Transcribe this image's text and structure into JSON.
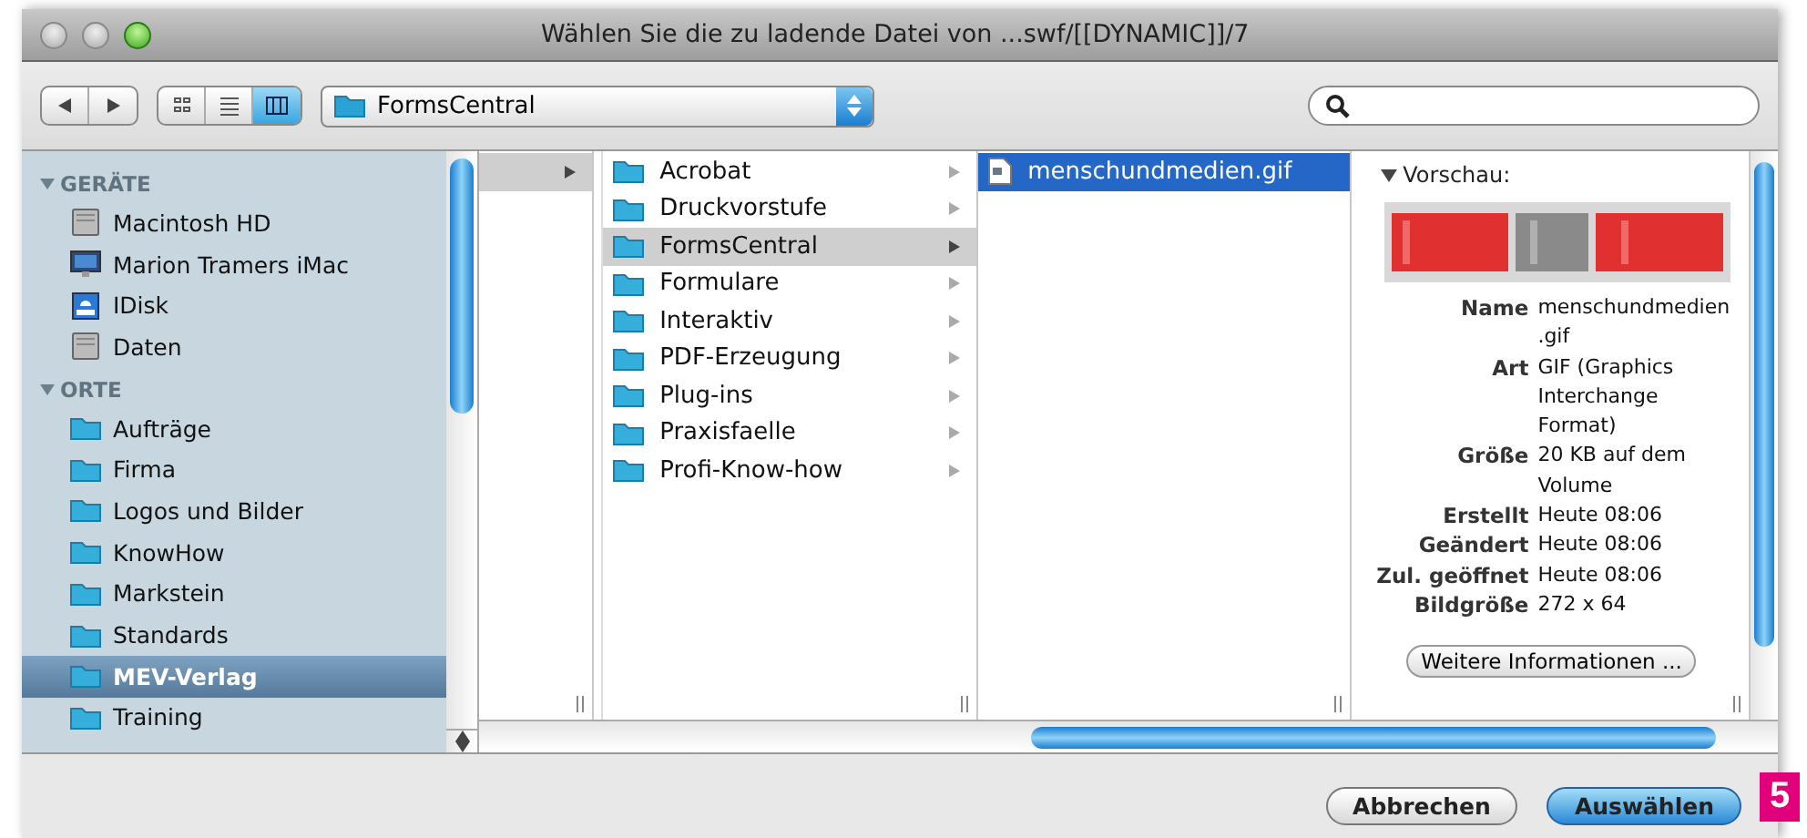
{
  "window": {
    "title": "Wählen Sie die zu ladende Datei von ...swf/[[DYNAMIC]]/7"
  },
  "toolbar": {
    "view_modes": [
      {
        "kind": "icons",
        "selected": false
      },
      {
        "kind": "list",
        "selected": false
      },
      {
        "kind": "columns",
        "selected": true
      }
    ],
    "location": "FormsCentral"
  },
  "sidebar": {
    "sections": [
      {
        "title": "GERÄTE",
        "expanded": true,
        "items": [
          {
            "label": "Macintosh HD",
            "kind": "disk",
            "selected": false
          },
          {
            "label": "Marion Tramers iMac",
            "kind": "computer",
            "selected": false
          },
          {
            "label": "IDisk",
            "kind": "idisk",
            "selected": false
          },
          {
            "label": "Daten",
            "kind": "disk",
            "selected": false
          }
        ]
      },
      {
        "title": "ORTE",
        "expanded": true,
        "items": [
          {
            "label": "Aufträge",
            "kind": "folder",
            "selected": false
          },
          {
            "label": "Firma",
            "kind": "folder",
            "selected": false
          },
          {
            "label": "Logos und Bilder",
            "kind": "folder",
            "selected": false
          },
          {
            "label": "KnowHow",
            "kind": "folder",
            "selected": false
          },
          {
            "label": "Markstein",
            "kind": "folder",
            "selected": false
          },
          {
            "label": "Standards",
            "kind": "folder",
            "selected": false
          },
          {
            "label": "MEV-Verlag",
            "kind": "folder",
            "selected": true
          },
          {
            "label": "Training",
            "kind": "folder",
            "selected": false
          }
        ]
      }
    ]
  },
  "columns": [
    {
      "active": false,
      "items": [
        {
          "kind": "blank",
          "selected": true,
          "has_children": true
        }
      ]
    },
    {
      "active": false,
      "items": [
        {
          "label": "Acrobat",
          "kind": "folder",
          "selected": false,
          "has_children": true
        },
        {
          "label": "Druckvorstufe",
          "kind": "folder",
          "selected": false,
          "has_children": true
        },
        {
          "label": "FormsCentral",
          "kind": "folder",
          "selected": true,
          "has_children": true
        },
        {
          "label": "Formulare",
          "kind": "folder",
          "selected": false,
          "has_children": true
        },
        {
          "label": "Interaktiv",
          "kind": "folder",
          "selected": false,
          "has_children": true
        },
        {
          "label": "PDF-Erzeugung",
          "kind": "folder",
          "selected": false,
          "has_children": true
        },
        {
          "label": "Plug-ins",
          "kind": "folder",
          "selected": false,
          "has_children": true
        },
        {
          "label": "Praxisfaelle",
          "kind": "folder",
          "selected": false,
          "has_children": true
        },
        {
          "label": "Profi-Know-how",
          "kind": "folder",
          "selected": false,
          "has_children": true
        }
      ]
    },
    {
      "active": true,
      "items": [
        {
          "label": "menschundmedien.gif",
          "kind": "file",
          "selected": true,
          "has_children": false
        }
      ]
    }
  ],
  "preview": {
    "title": "Vorschau:",
    "expanded": true,
    "fields": [
      {
        "label": "Name",
        "lines": [
          "menschundmedien",
          ".gif"
        ]
      },
      {
        "label": "Art",
        "lines": [
          "GIF (Graphics",
          "Interchange",
          "Format)"
        ]
      },
      {
        "label": "Größe",
        "lines": [
          "20 KB auf dem",
          "Volume"
        ]
      },
      {
        "label": "Erstellt",
        "lines": [
          "Heute 08:06"
        ]
      },
      {
        "label": "Geändert",
        "lines": [
          "Heute 08:06"
        ]
      },
      {
        "label": "Zul. geöffnet",
        "lines": [
          "Heute 08:06"
        ]
      },
      {
        "label": "Bildgröße",
        "lines": [
          "272 x 64"
        ]
      }
    ],
    "more_button": "Weitere Informationen ..."
  },
  "buttons": [
    {
      "label": "Abbrechen",
      "default": false
    },
    {
      "label": "Auswählen",
      "default": true
    }
  ],
  "callout_badge": "5"
}
